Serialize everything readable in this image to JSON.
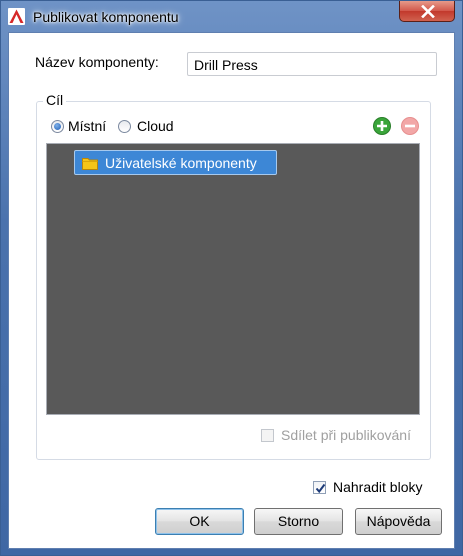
{
  "window": {
    "title": "Publikovat komponentu",
    "close_icon": "close-icon"
  },
  "form": {
    "name_label": "Název komponenty:",
    "name_value": "Drill Press"
  },
  "target": {
    "group_label": "Cíl",
    "radio_local_label": "Místní",
    "radio_local_checked": true,
    "radio_cloud_label": "Cloud",
    "radio_cloud_checked": false,
    "add_icon": "plus-circle-icon",
    "remove_icon": "minus-circle-icon",
    "tree_items": [
      {
        "label": "Uživatelské komponenty",
        "icon": "folder-icon",
        "selected": true
      }
    ],
    "share_label": "Sdílet při publikování",
    "share_checked": false,
    "share_enabled": false
  },
  "replace_blocks": {
    "label": "Nahradit bloky",
    "checked": true
  },
  "buttons": {
    "ok": "OK",
    "cancel": "Storno",
    "help": "Nápověda"
  },
  "colors": {
    "title_bar": "#4a72ad",
    "close_button": "#c2392c",
    "tree_background": "#595959",
    "selection": "#3d87d6",
    "add_icon": "#3aa53a",
    "remove_icon": "#f2a7a7"
  }
}
